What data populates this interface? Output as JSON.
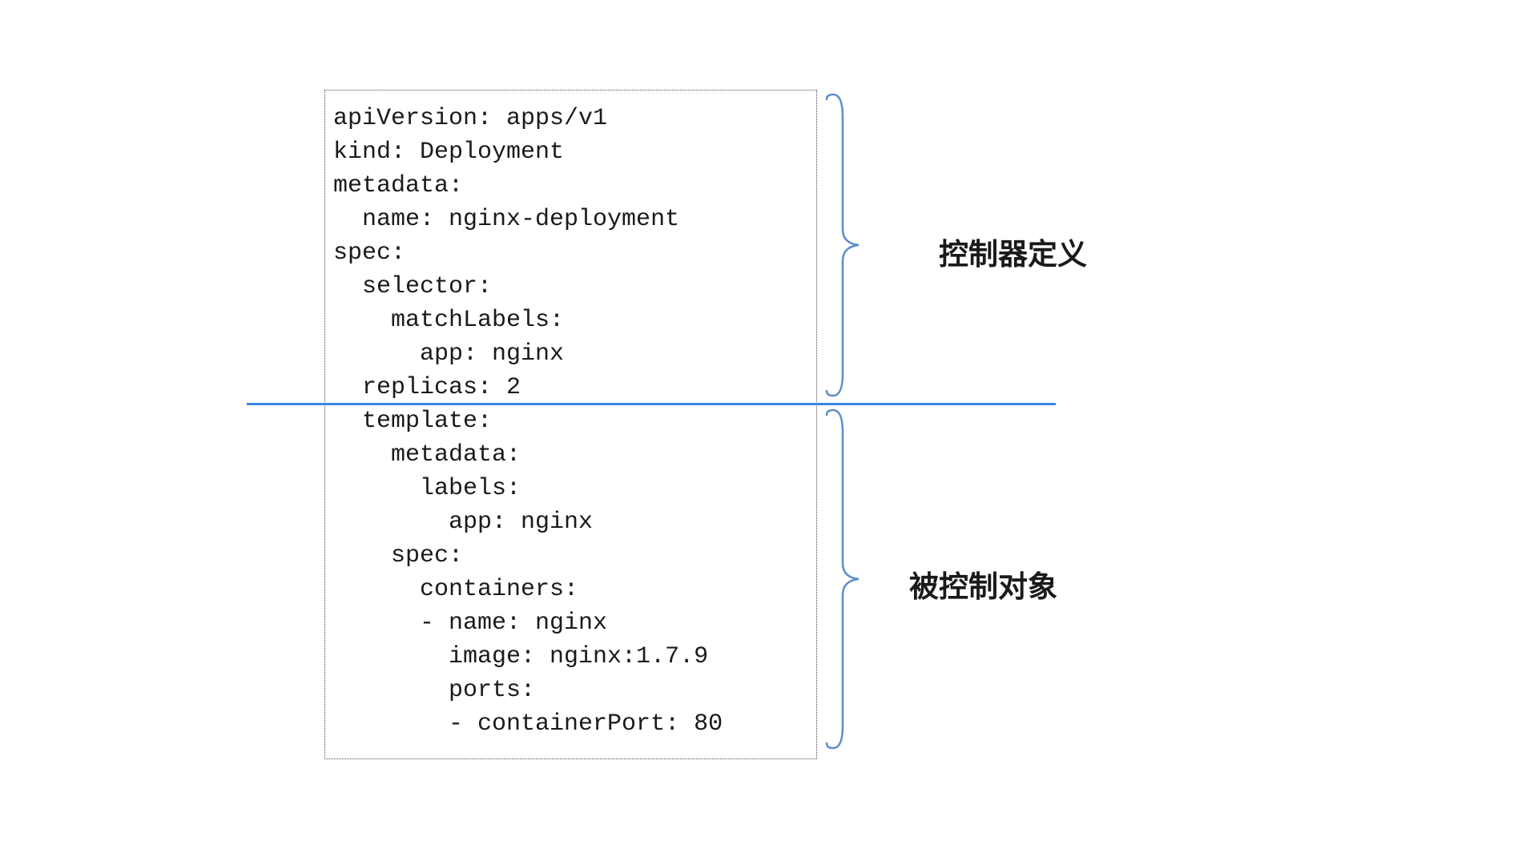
{
  "code": {
    "l1": "apiVersion: apps/v1",
    "l2": "kind: Deployment",
    "l3": "metadata:",
    "l4": "  name: nginx-deployment",
    "l5": "spec:",
    "l6": "  selector:",
    "l7": "    matchLabels:",
    "l8": "      app: nginx",
    "l9": "  replicas: 2",
    "l10": "  template:",
    "l11": "    metadata:",
    "l12": "      labels:",
    "l13": "        app: nginx",
    "l14": "    spec:",
    "l15": "      containers:",
    "l16": "      - name: nginx",
    "l17": "        image: nginx:1.7.9",
    "l18": "        ports:",
    "l19": "        - containerPort: 80"
  },
  "labels": {
    "top": "控制器定义",
    "bottom": "被控制对象"
  },
  "colors": {
    "bracket": "#5f8ecb",
    "divider": "#3a85e0",
    "border": "#4a4a4a"
  }
}
